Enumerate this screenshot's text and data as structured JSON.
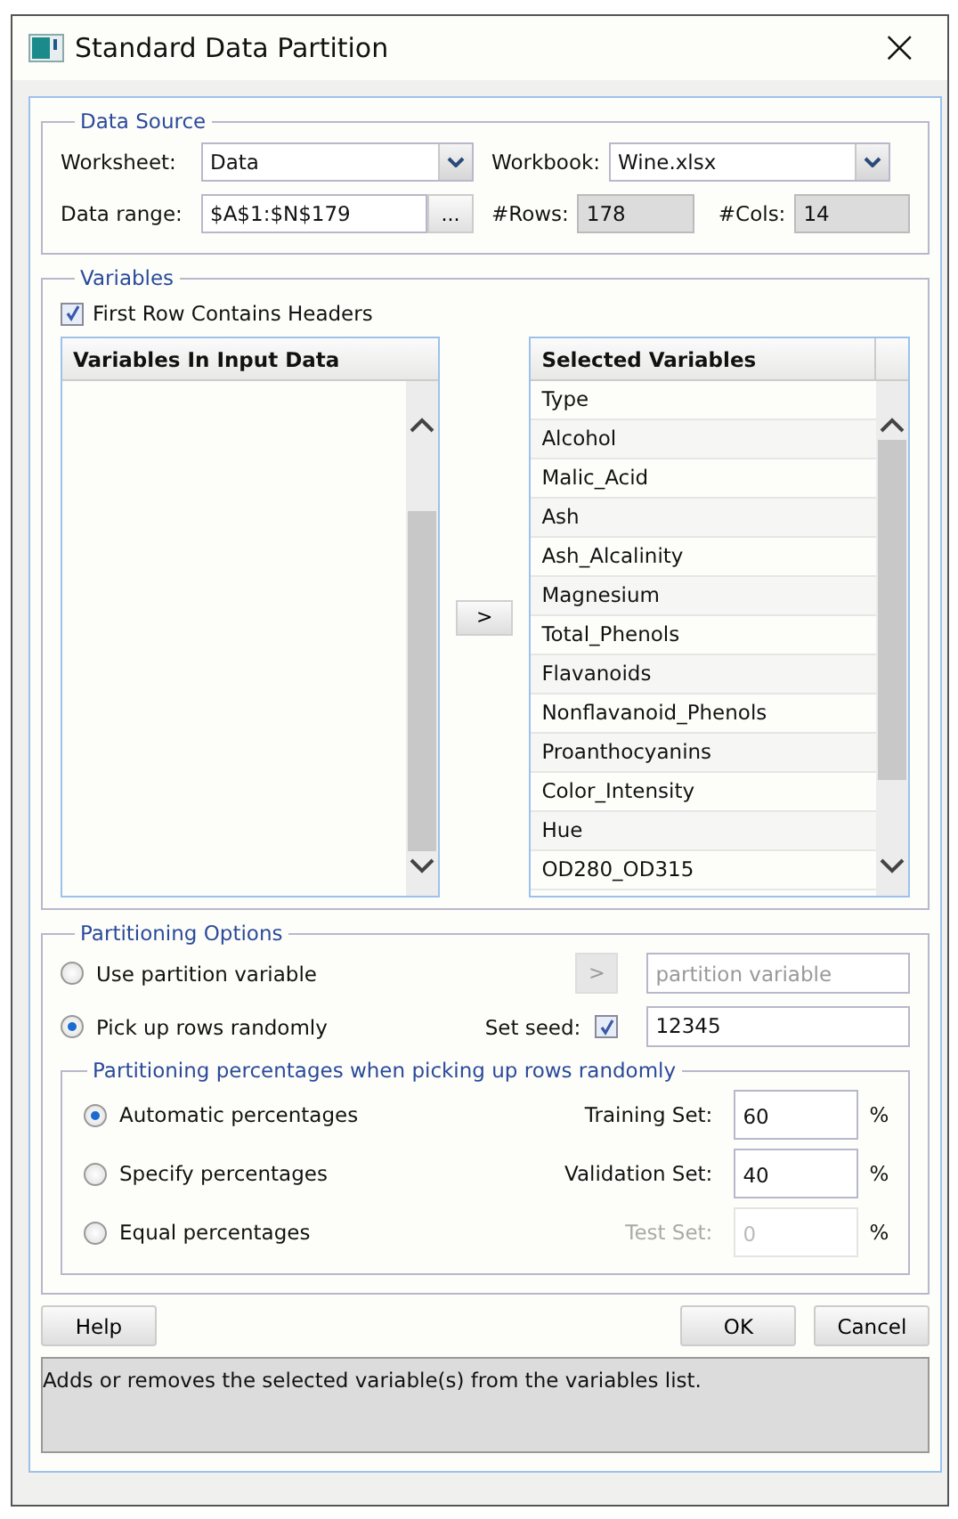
{
  "window": {
    "title": "Standard Data Partition",
    "close": "×"
  },
  "data_source": {
    "title": "Data Source",
    "worksheet": {
      "label": "Worksheet:",
      "value": "Data"
    },
    "workbook": {
      "label": "Workbook:",
      "value": "Wine.xlsx"
    },
    "data_range": {
      "label": "Data range:",
      "value": "$A$1:$N$179",
      "button": "..."
    },
    "rows": {
      "label": "#Rows:",
      "value": "178"
    },
    "cols": {
      "label": "#Cols:",
      "value": "14"
    }
  },
  "variables": {
    "title": "Variables",
    "first_row_headers": {
      "label": "First Row Contains Headers",
      "checked": true
    },
    "input_list": {
      "header": "Variables In Input Data"
    },
    "move_button": ">",
    "selected_list": {
      "header": "Selected Variables",
      "items": [
        "Type",
        "Alcohol",
        "Malic_Acid",
        "Ash",
        "Ash_Alcalinity",
        "Magnesium",
        "Total_Phenols",
        "Flavanoids",
        "Nonflavanoid_Phenols",
        "Proanthocyanins",
        "Color_Intensity",
        "Hue",
        "OD280_OD315"
      ]
    }
  },
  "partitioning": {
    "title": "Partitioning Options",
    "options": [
      {
        "label": "Use partition variable",
        "selected": false
      },
      {
        "label": "Pick up rows randomly",
        "selected": true
      }
    ],
    "partition_button": ">",
    "partition_field": {
      "placeholder": "partition variable"
    },
    "seed": {
      "label": "Set seed:",
      "checked": true,
      "value": "12345"
    },
    "percentages": {
      "title": "Partitioning percentages when picking up rows randomly",
      "modes": [
        {
          "label": "Automatic percentages",
          "selected": true
        },
        {
          "label": "Specify percentages",
          "selected": false
        },
        {
          "label": "Equal percentages",
          "selected": false
        }
      ],
      "fields": [
        {
          "label": "Training Set:",
          "value": "60",
          "unit": "%",
          "disabled": false
        },
        {
          "label": "Validation Set:",
          "value": "40",
          "unit": "%",
          "disabled": false
        },
        {
          "label": "Test Set:",
          "value": "0",
          "unit": "%",
          "disabled": true
        }
      ]
    }
  },
  "buttons": {
    "help": "Help",
    "ok": "OK",
    "cancel": "Cancel"
  },
  "status": "Adds or removes the selected variable(s) from the variables list."
}
